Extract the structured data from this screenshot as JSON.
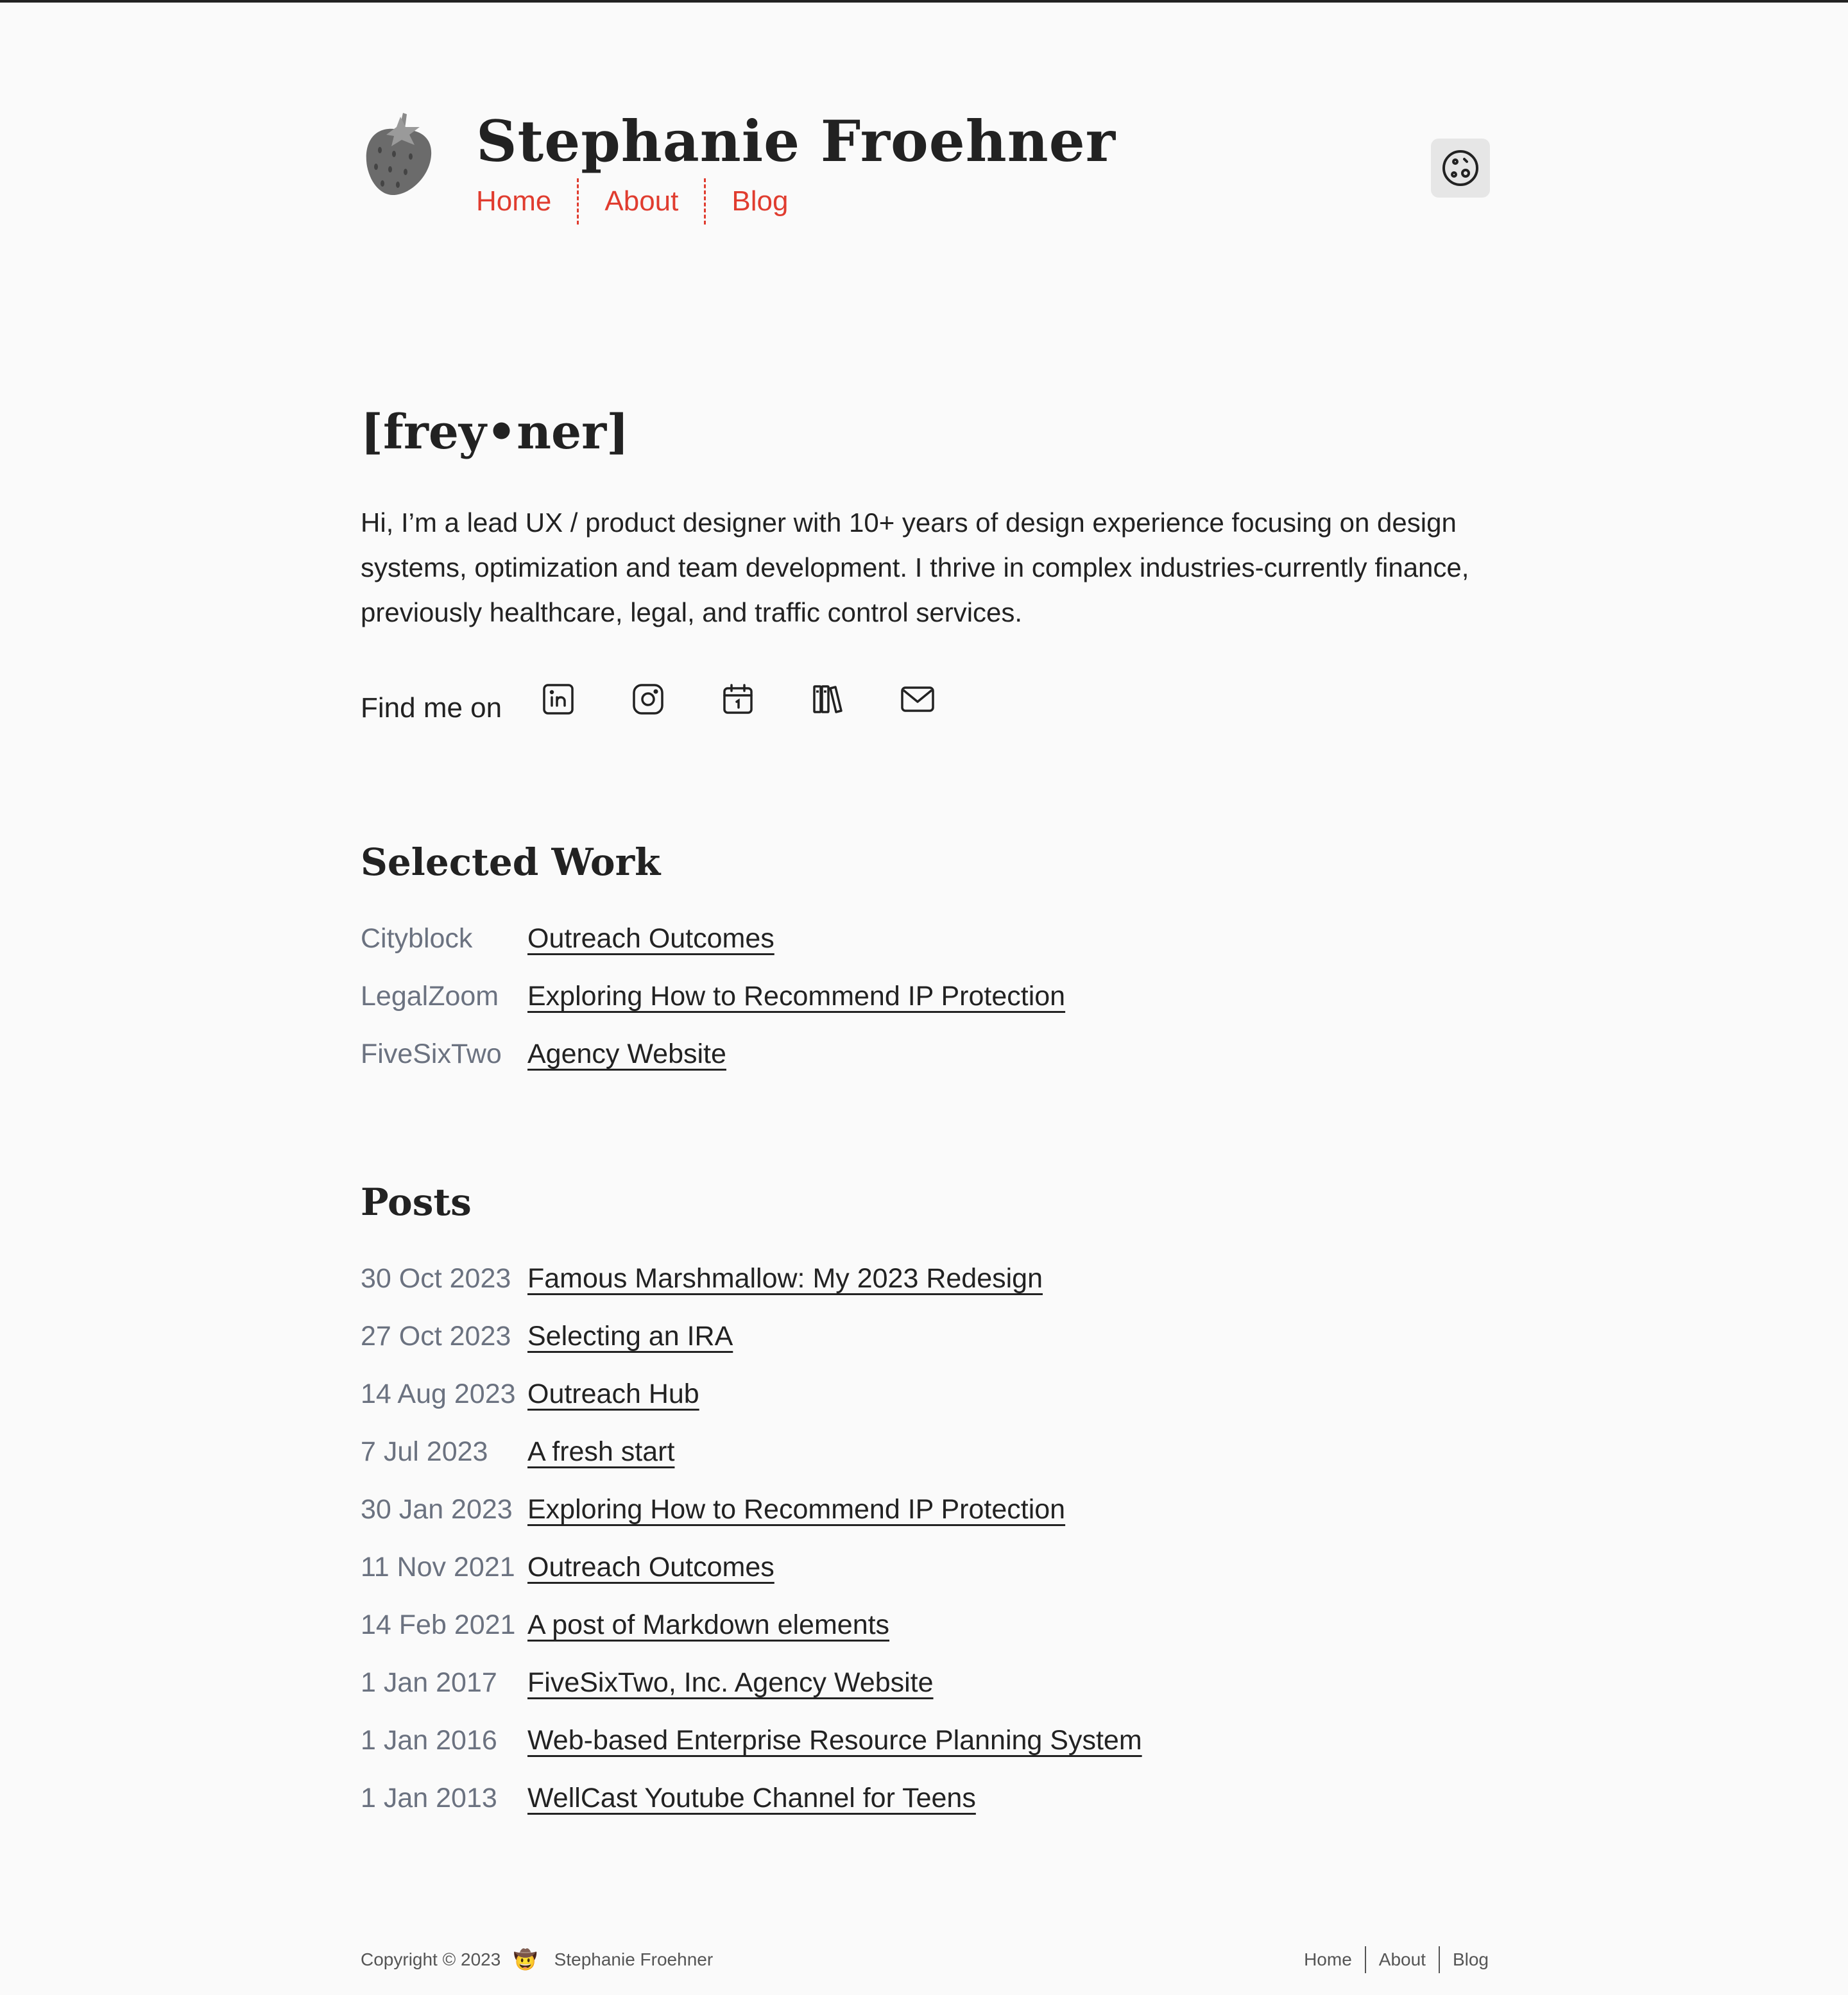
{
  "header": {
    "site_title": "Stephanie Froehner",
    "nav": [
      {
        "label": "Home"
      },
      {
        "label": "About"
      },
      {
        "label": "Blog"
      }
    ]
  },
  "hero": {
    "phonetic": "[frey•ner]",
    "intro": "Hi, I’m a lead UX / product designer with 10+ years of design experience focusing on design systems, optimization and team development. I thrive in complex industries-currently finance, previously healthcare, legal, and traffic control services.",
    "find_me_label": "Find me on",
    "social_icons": [
      "linkedin-icon",
      "instagram-icon",
      "calendar-icon",
      "library-icon",
      "mail-icon"
    ]
  },
  "selected_work": {
    "title": "Selected Work",
    "items": [
      {
        "company": "Cityblock",
        "title": "Outreach Outcomes"
      },
      {
        "company": "LegalZoom",
        "title": "Exploring How to Recommend IP Protection"
      },
      {
        "company": "FiveSixTwo",
        "title": "Agency Website"
      }
    ]
  },
  "posts": {
    "title": "Posts",
    "items": [
      {
        "date": "30 Oct 2023",
        "title": "Famous Marshmallow: My 2023 Redesign"
      },
      {
        "date": "27 Oct 2023",
        "title": "Selecting an IRA"
      },
      {
        "date": "14 Aug 2023",
        "title": "Outreach Hub"
      },
      {
        "date": "7 Jul 2023",
        "title": "A fresh start"
      },
      {
        "date": "30 Jan 2023",
        "title": "Exploring How to Recommend IP Protection"
      },
      {
        "date": "11 Nov 2021",
        "title": "Outreach Outcomes"
      },
      {
        "date": "14 Feb 2021",
        "title": "A post of Markdown elements"
      },
      {
        "date": "1 Jan 2017",
        "title": "FiveSixTwo, Inc. Agency Website"
      },
      {
        "date": "1 Jan 2016",
        "title": "Web-based Enterprise Resource Planning System"
      },
      {
        "date": "1 Jan 2013",
        "title": "WellCast Youtube Channel for Teens"
      }
    ]
  },
  "footer": {
    "copyright": "Copyright © 2023",
    "emoji": "🤠",
    "name": "Stephanie Froehner",
    "nav": [
      {
        "label": "Home"
      },
      {
        "label": "About"
      },
      {
        "label": "Blog"
      }
    ]
  },
  "colors": {
    "accent": "#e03c2f",
    "text": "#222222",
    "muted": "#6b7280",
    "background": "#fafafa"
  }
}
